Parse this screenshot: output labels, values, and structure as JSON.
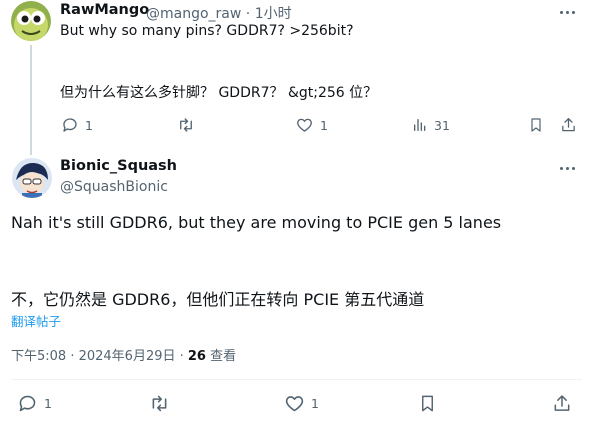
{
  "reply": {
    "author_name": "RawMango",
    "author_handle": "@mango_raw",
    "separator": " · ",
    "time": "1小时",
    "text": "But why so many pins? GDDR7? >256bit?",
    "translation": "但为什么有这么多针脚？ GDDR7？ &gt;256 位？",
    "actions": {
      "reply_count": "1",
      "repost_count": "",
      "like_count": "1",
      "views_count": "31"
    },
    "icons": [
      "reply-icon",
      "repost-icon",
      "like-icon",
      "views-icon",
      "bookmark-icon",
      "share-icon"
    ]
  },
  "main": {
    "author_name": "Bionic_Squash",
    "author_handle": "@SquashBionic",
    "text": "Nah it's still GDDR6, but they are moving to PCIE gen 5 lanes",
    "translation": "不，它仍然是 GDDR6，但他们正在转向 PCIE 第五代通道",
    "translate_link": "翻译帖子",
    "timestamp": "下午5:08 · 2024年6月29日 · ",
    "views_number": "26",
    "views_label": " 查看",
    "actions": {
      "reply_count": "1",
      "repost_count": "",
      "like_count": "1"
    },
    "icons": [
      "reply-icon",
      "repost-icon",
      "like-icon",
      "bookmark-icon",
      "share-icon"
    ]
  },
  "colors": {
    "text_primary": "#0f1419",
    "text_secondary": "#536471",
    "link": "#1d9bf0",
    "divider": "#eff3f4",
    "thread_line": "#cfd9de"
  }
}
